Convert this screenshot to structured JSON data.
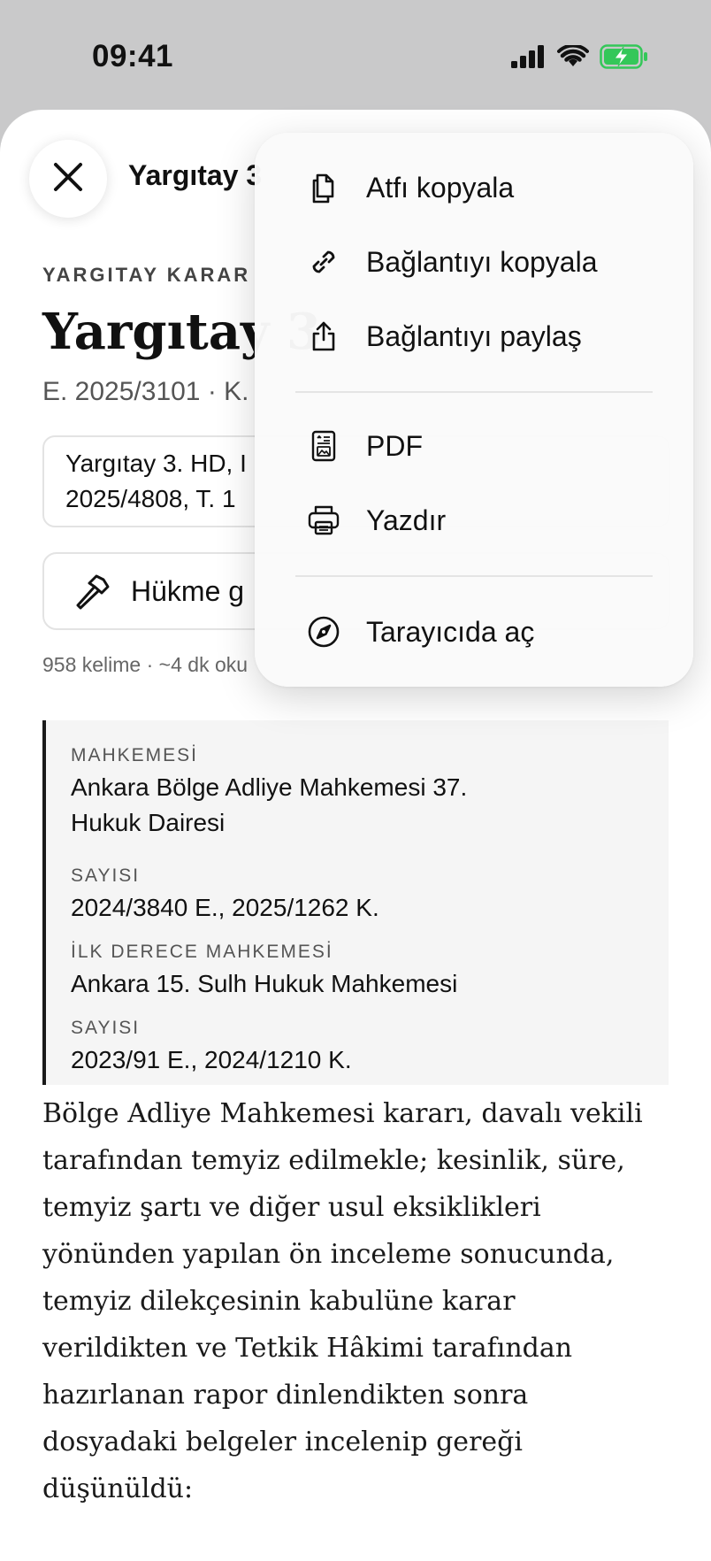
{
  "status_bar": {
    "time": "09:41",
    "icons": [
      "cellular-signal-icon",
      "wifi-icon",
      "battery-charging-icon"
    ],
    "battery_color": "#34c759"
  },
  "nav": {
    "close_icon": "close-icon",
    "title": "Yargıtay 3"
  },
  "document": {
    "eyebrow": "YARGITAY KARAR",
    "title": "Yargıtay 3",
    "meta": "E. 2025/3101 · K.",
    "citation_line1": "Yargıtay 3. HD, I",
    "citation_line2": "2025/4808, T. 1",
    "action_label": "Hükme g",
    "reading_info": "958 kelime · ~4 dk oku",
    "info": [
      {
        "label": "MAHKEMESİ",
        "value_lines": [
          "Ankara Bölge Adliye Mahkemesi 37.",
          "Hukuk Dairesi"
        ]
      },
      {
        "label": "SAYISI",
        "value_lines": [
          "2024/3840 E., 2025/1262 K."
        ]
      },
      {
        "label": "İLK DERECE MAHKEMESİ",
        "value_lines": [
          "Ankara 15. Sulh Hukuk Mahkemesi"
        ]
      },
      {
        "label": "SAYISI",
        "value_lines": [
          "2023/91 E., 2024/1210 K."
        ]
      }
    ],
    "body_lines": [
      "Bölge Adliye Mahkemesi kararı, davalı vekili",
      "tarafından temyiz edilmekle; kesinlik, süre,",
      "temyiz şartı ve diğer usul eksiklikleri",
      "yönünden yapılan ön inceleme sonucunda,",
      "temyiz dilekçesinin kabulüne karar",
      "verildikten ve Tetkik Hâkimi tarafından",
      "hazırlanan rapor dinlendikten sonra",
      "dosyadaki belgeler incelenip gereği",
      "düşünüldü:"
    ]
  },
  "menu": {
    "items": [
      {
        "label": "Atfı kopyala",
        "icon": "copy-citation-icon"
      },
      {
        "label": "Bağlantıyı kopyala",
        "icon": "link-icon"
      },
      {
        "label": "Bağlantıyı paylaş",
        "icon": "share-icon"
      },
      {
        "label": "PDF",
        "icon": "pdf-document-icon"
      },
      {
        "label": "Yazdır",
        "icon": "printer-icon"
      },
      {
        "label": "Tarayıcıda aç",
        "icon": "compass-icon"
      }
    ]
  }
}
